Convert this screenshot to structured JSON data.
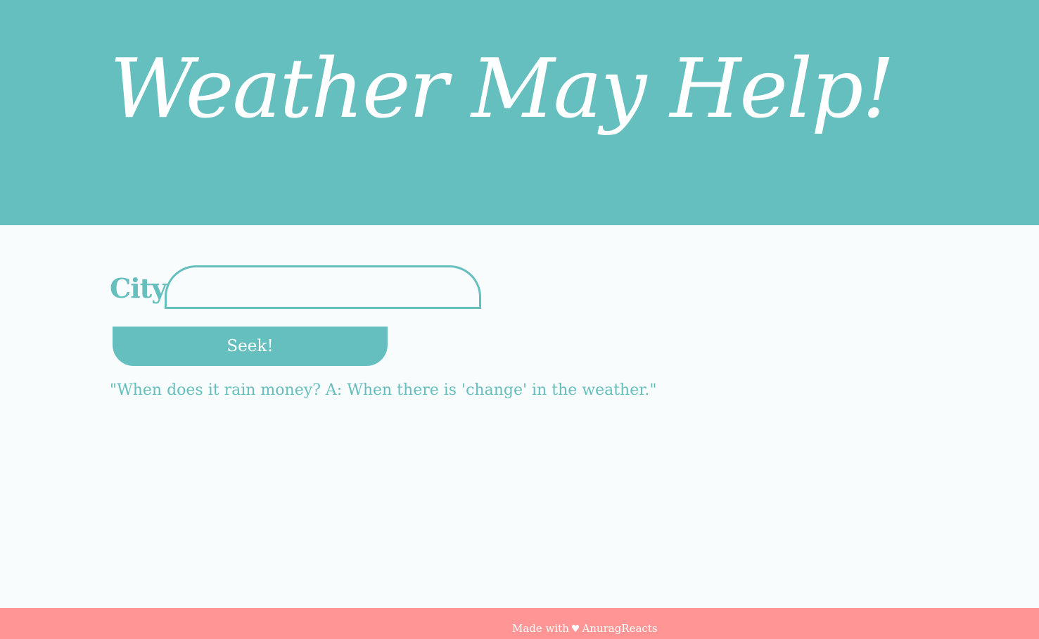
{
  "header": {
    "title": "Weather May Help!"
  },
  "form": {
    "city_label": "City",
    "city_input_value": "",
    "city_input_placeholder": "",
    "seek_label": "Seek!"
  },
  "quote": "\"When does it rain money? A: When there is 'change' in the weather.\"",
  "footer": {
    "made_with": "Made with",
    "heart_icon": "♥",
    "author": "AnuragReacts"
  },
  "colors": {
    "primary": "#66bfbf",
    "background": "#f9fcfc",
    "footer": "#ff9595",
    "text_light": "#ffffff"
  }
}
